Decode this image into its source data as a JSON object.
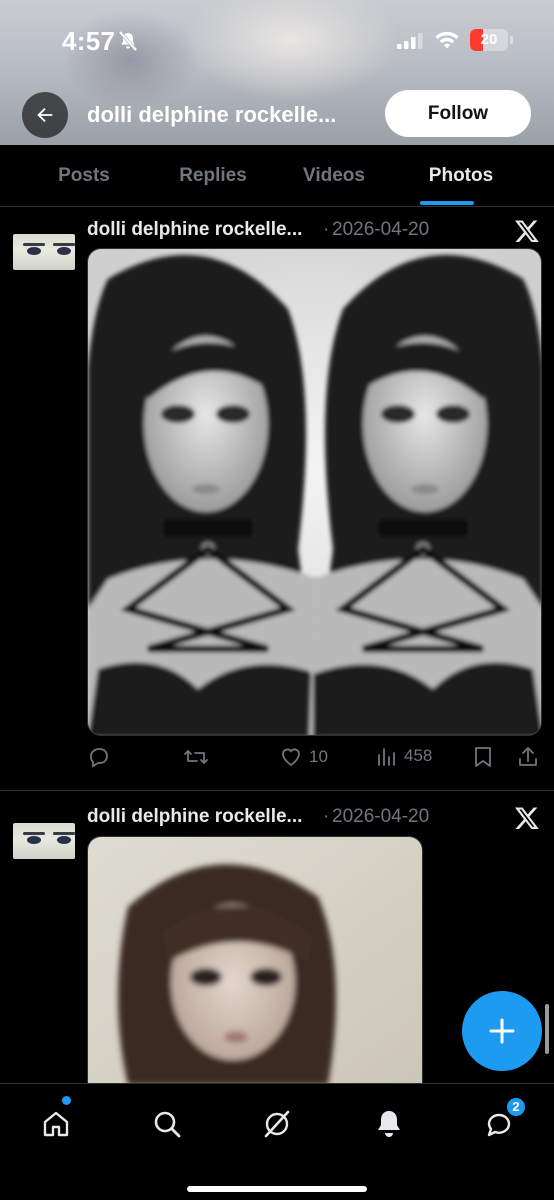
{
  "status_bar": {
    "time": "4:57",
    "battery_level": "20",
    "battery_color": "#ff3b30"
  },
  "profile": {
    "name": "dolli delphine rockelle...",
    "follow_label": "Follow"
  },
  "tabs": [
    {
      "label": "Posts",
      "active": false
    },
    {
      "label": "Replies",
      "active": false
    },
    {
      "label": "Videos",
      "active": false
    },
    {
      "label": "Photos",
      "active": true
    }
  ],
  "posts": [
    {
      "author": "dolli delphine rockelle...",
      "separator": "·",
      "date": "2026-04-20",
      "media_description": "mirrored black-and-white portrait",
      "actions": {
        "reply": "",
        "repost": "",
        "likes": "10",
        "views": "458"
      }
    },
    {
      "author": "dolli delphine rockelle...",
      "separator": "·",
      "date": "2026-04-20",
      "media_description": "color portrait"
    }
  ],
  "icons": {
    "back": "arrow-left-icon",
    "x_logo": "x-logo-icon",
    "compose": "plus-icon",
    "nav": [
      "home-icon",
      "search-icon",
      "grok-icon",
      "notifications-bell-icon",
      "messages-icon"
    ]
  },
  "bottom_nav": {
    "messages_badge": "2"
  },
  "colors": {
    "accent": "#1d9bf0",
    "background": "#000000",
    "muted_text": "#71767b"
  }
}
